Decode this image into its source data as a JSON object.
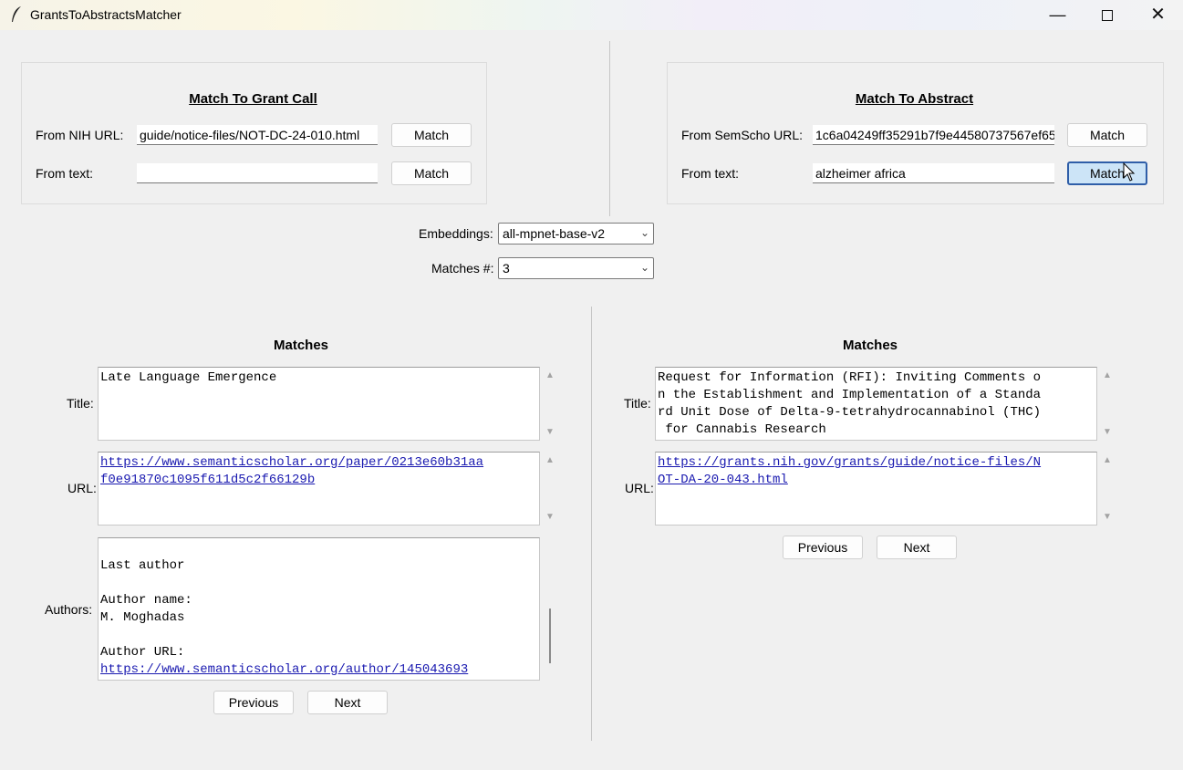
{
  "window": {
    "title": "GrantsToAbstractsMatcher"
  },
  "left_group": {
    "heading": "Match To Grant Call",
    "nih_label": "From NIH URL:",
    "nih_value": "guide/notice-files/NOT-DC-24-010.html",
    "text_label": "From text:",
    "text_value": "",
    "match_label": "Match"
  },
  "right_group": {
    "heading": "Match To Abstract",
    "semscho_label": "From SemScho URL:",
    "semscho_value": "1c6a04249ff35291b7f9e44580737567ef655",
    "text_label": "From text:",
    "text_value": "alzheimer africa",
    "match_label": "Match"
  },
  "options": {
    "embeddings_label": "Embeddings:",
    "embeddings_value": "all-mpnet-base-v2",
    "matches_label": "Matches #:",
    "matches_value": "3"
  },
  "left_results": {
    "heading": "Matches",
    "title_label": "Title:",
    "title_text": "Late Language Emergence",
    "url_label": "URL:",
    "url_line1": "https://www.semanticscholar.org/paper/0213e60b31aa",
    "url_line2": "f0e91870c1095f611d5c2f66129b",
    "authors_label": "Authors:",
    "authors_last": "Last author",
    "authors_name_label": "Author name:",
    "authors_name": "M. Moghadas",
    "authors_url_label": "Author URL:",
    "authors_url": "https://www.semanticscholar.org/author/145043693",
    "previous_label": "Previous",
    "next_label": "Next"
  },
  "right_results": {
    "heading": "Matches",
    "title_label": "Title:",
    "title_line1": "Request for Information (RFI): Inviting Comments o",
    "title_line2": "n the Establishment and Implementation of a Standa",
    "title_line3": "rd Unit Dose of Delta-9-tetrahydrocannabinol (THC)",
    "title_line4": " for Cannabis Research",
    "url_label": "URL:",
    "url_line1": "https://grants.nih.gov/grants/guide/notice-files/N",
    "url_line2": "OT-DA-20-043.html",
    "previous_label": "Previous",
    "next_label": "Next"
  }
}
